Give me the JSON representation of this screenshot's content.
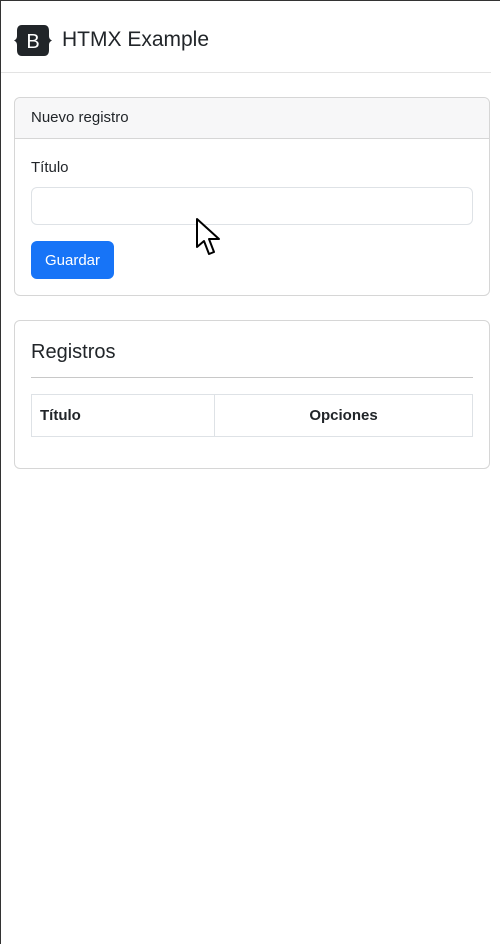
{
  "navbar": {
    "brand_letter": "B",
    "brand_title": "HTMX Example"
  },
  "new_record": {
    "header": "Nuevo registro",
    "title_label": "Título",
    "title_value": "",
    "title_placeholder": "",
    "save_label": "Guardar"
  },
  "records": {
    "heading": "Registros",
    "columns": [
      "Título",
      "Opciones"
    ],
    "rows": []
  },
  "colors": {
    "primary": "#1774f7",
    "brand_logo": "#212529"
  }
}
